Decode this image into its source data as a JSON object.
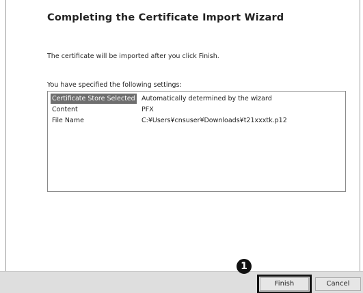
{
  "wizard": {
    "title": "Completing the Certificate Import Wizard",
    "info_text": "The certificate will be imported after you click Finish.",
    "settings_label": "You have specified the following settings:",
    "settings": [
      {
        "key": "Certificate Store Selected",
        "value": "Automatically determined by the wizard",
        "selected": true
      },
      {
        "key": "Content",
        "value": "PFX",
        "selected": false
      },
      {
        "key": "File Name",
        "value": "C:¥Users¥cnsuser¥Downloads¥t21xxxtk.p12",
        "selected": false
      }
    ]
  },
  "buttons": {
    "finish_label": "Finish",
    "cancel_label": "Cancel"
  },
  "annotation": {
    "step_number": "1"
  },
  "colors": {
    "selected_row_bg": "#6e6e6e",
    "footer_bg": "#dedede",
    "highlight": "#111111"
  }
}
